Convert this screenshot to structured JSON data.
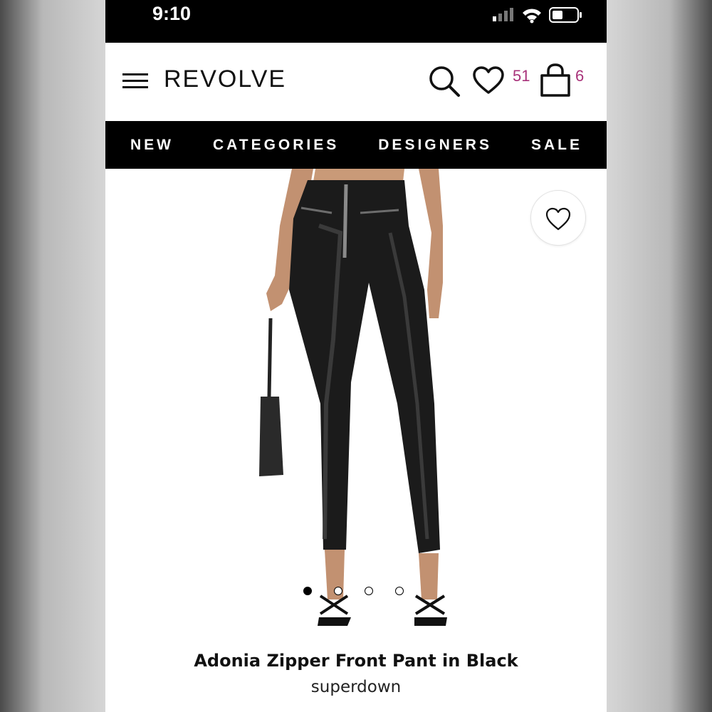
{
  "status_bar": {
    "time": "9:10"
  },
  "header": {
    "logo": "REVOLVE",
    "wishlist_count": "51",
    "bag_count": "6"
  },
  "nav": {
    "items": [
      {
        "label": "NEW"
      },
      {
        "label": "CATEGORIES"
      },
      {
        "label": "DESIGNERS"
      },
      {
        "label": "SALE"
      }
    ]
  },
  "product": {
    "name": "Adonia Zipper Front Pant in Black",
    "brand": "superdown",
    "image_count": 4,
    "active_image": 1
  },
  "colors": {
    "accent": "#a8327a",
    "nav_background": "#000000",
    "status_bar": "#000000"
  },
  "icons": [
    "menu-icon",
    "search-icon",
    "heart-icon",
    "bag-icon",
    "signal-icon",
    "wifi-icon",
    "battery-icon"
  ]
}
